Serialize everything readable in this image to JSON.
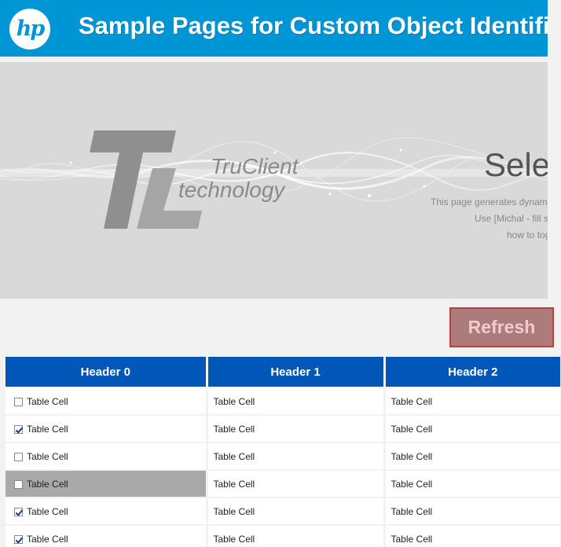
{
  "header": {
    "logo_text": "hp",
    "title": "Sample Pages for Custom Object Identifi"
  },
  "banner": {
    "brand_line1": "TruClient",
    "brand_line2": "technology",
    "heading": "Select",
    "lines": [
      "This page generates dynamic",
      "Use [Michal - fill scri",
      "how to togg"
    ]
  },
  "actions": {
    "refresh_label": "Refresh"
  },
  "table": {
    "headers": [
      "Header 0",
      "Header 1",
      "Header 2"
    ],
    "rows": [
      {
        "checked": false,
        "selected": false,
        "cells": [
          "Table Cell",
          "Table Cell",
          "Table Cell"
        ]
      },
      {
        "checked": true,
        "selected": false,
        "cells": [
          "Table Cell",
          "Table Cell",
          "Table Cell"
        ]
      },
      {
        "checked": false,
        "selected": false,
        "cells": [
          "Table Cell",
          "Table Cell",
          "Table Cell"
        ]
      },
      {
        "checked": false,
        "selected": true,
        "cells": [
          "Table Cell",
          "Table Cell",
          "Table Cell"
        ]
      },
      {
        "checked": true,
        "selected": false,
        "cells": [
          "Table Cell",
          "Table Cell",
          "Table Cell"
        ]
      },
      {
        "checked": true,
        "selected": false,
        "cells": [
          "Table Cell",
          "Table Cell",
          "Table Cell"
        ]
      }
    ]
  },
  "colors": {
    "header_blue": "#0096d6",
    "table_header_blue": "#0057b7",
    "refresh_bg": "#ad7b7b",
    "refresh_border": "#c13f3f",
    "selected_cell": "#a9a9a9"
  },
  "icons": {
    "logo": "hp-logo-icon",
    "checkbox": "checkbox-icon"
  }
}
